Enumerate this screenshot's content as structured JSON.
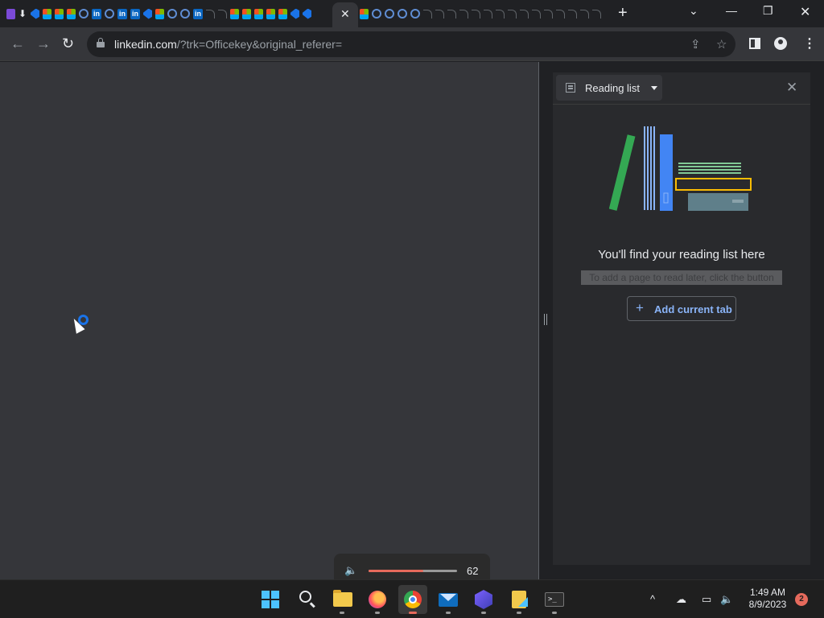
{
  "browser": {
    "tab_close_label": "✕",
    "new_tab_label": "+",
    "window_controls": {
      "tab_search": "⌄",
      "minimize": "—",
      "restore": "❐",
      "close": "✕"
    },
    "nav": {
      "back": "←",
      "forward": "→",
      "reload": "↻"
    },
    "address": {
      "host": "linkedin.com",
      "path": "/?trk=Officekey&original_referer="
    },
    "omnibox_icons": [
      "share-icon",
      "bookmark-star-icon"
    ],
    "toolbar_icons": [
      "side-panel-icon",
      "profile-icon",
      "menu-icon"
    ]
  },
  "side_panel": {
    "selector_label": "Reading list",
    "close_label": "✕",
    "empty_title": "You'll find your reading list here",
    "empty_subtitle": "To add a page to read later, click the button",
    "add_button_label": "Add current tab",
    "add_button_icon": "+"
  },
  "volume_flyout": {
    "speaker_icon": "🔈",
    "level": 62,
    "level_label": "62",
    "accent_color": "#e66a5c"
  },
  "taskbar": {
    "apps": [
      "start",
      "search",
      "file-explorer",
      "firefox",
      "chrome",
      "mail",
      "app-hex",
      "notes",
      "terminal"
    ],
    "active_app": "chrome",
    "tray": {
      "overflow": "^",
      "time": "1:49 AM",
      "date": "8/9/2023",
      "notification_count": "2"
    }
  },
  "colors": {
    "accent": "#8ab4f8",
    "loading_spinner": "#1a73e8",
    "windows_blue": "#4cc2ff"
  }
}
